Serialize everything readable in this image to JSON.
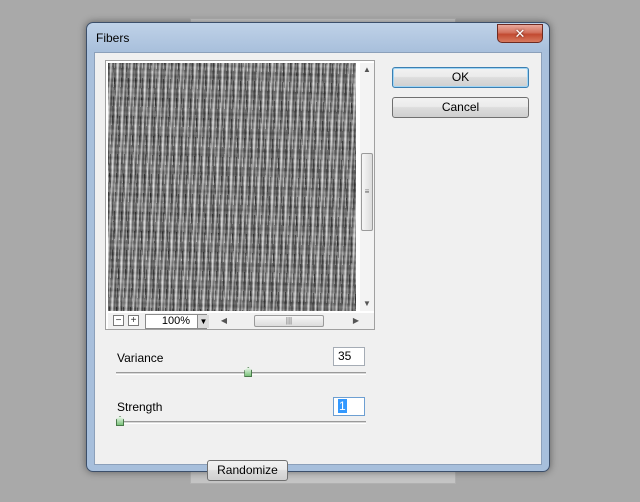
{
  "window": {
    "title": "Fibers",
    "close_label": "✕"
  },
  "buttons": {
    "ok_label": "OK",
    "cancel_label": "Cancel",
    "randomize_label": "Randomize"
  },
  "preview": {
    "zoom_value": "100%",
    "zoom_out_label": "−",
    "zoom_in_label": "+"
  },
  "controls": {
    "variance": {
      "label": "Variance",
      "value": "35",
      "slider_fraction": 0.53
    },
    "strength": {
      "label": "Strength",
      "value": "1",
      "slider_fraction": 0.0
    }
  },
  "colors": {
    "title_bar": "#a9c0dc",
    "close_button": "#c24a31",
    "default_button_border": "#3c7fb1",
    "selection": "#3399ff"
  }
}
